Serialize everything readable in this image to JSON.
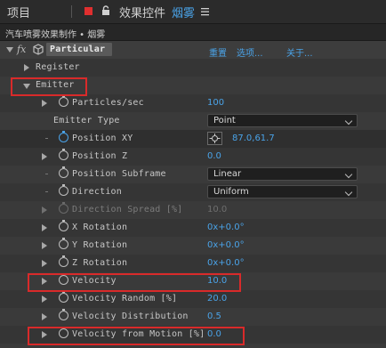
{
  "tabs": {
    "project": "项目",
    "effect_controls": "效果控件",
    "layer_name": "烟雾"
  },
  "breadcrumb": "汽车喷雾效果制作 • 烟雾",
  "effect": {
    "fx": "fx",
    "name": "Particular",
    "links": [
      "重置",
      "选项...",
      "关于..."
    ]
  },
  "groups": {
    "register": "Register",
    "emitter": "Emitter"
  },
  "params": [
    {
      "label": "Particles/sec",
      "value": "100"
    },
    {
      "label": "Emitter Type",
      "value": "Point"
    },
    {
      "label": "Position XY",
      "value": "87.0,61.7"
    },
    {
      "label": "Position Z",
      "value": "0.0"
    },
    {
      "label": "Position Subframe",
      "value": "Linear"
    },
    {
      "label": "Direction",
      "value": "Uniform"
    },
    {
      "label": "Direction Spread [%]",
      "value": "10.0"
    },
    {
      "label": "X Rotation",
      "value": "0x+0.0°"
    },
    {
      "label": "Y Rotation",
      "value": "0x+0.0°"
    },
    {
      "label": "Z Rotation",
      "value": "0x+0.0°"
    },
    {
      "label": "Velocity",
      "value": "10.0"
    },
    {
      "label": "Velocity Random [%]",
      "value": "20.0"
    },
    {
      "label": "Velocity Distribution",
      "value": "0.5"
    },
    {
      "label": "Velocity from Motion [%]",
      "value": "0.0"
    }
  ],
  "accent_color": "#4aa3e8",
  "highlight_color": "#d92a2a"
}
